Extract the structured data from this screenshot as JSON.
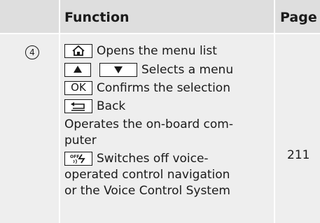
{
  "header": {
    "function_label": "Function",
    "page_label": "Page"
  },
  "row": {
    "number": "4",
    "lines": {
      "home": "Opens the menu list",
      "select": "Selects a menu",
      "ok_key": "OK",
      "confirm": "Confirms the selection",
      "back": "Back",
      "operates_1": "Operates the on-board com-",
      "operates_2": "puter",
      "voice_1": "Switches off voice-",
      "voice_2": "operated control navigation",
      "voice_3": "or the Voice Control System"
    },
    "page": "211",
    "icons": [
      "home-icon",
      "up-arrow-icon",
      "down-arrow-icon",
      "back-icon",
      "voice-off-icon"
    ]
  }
}
